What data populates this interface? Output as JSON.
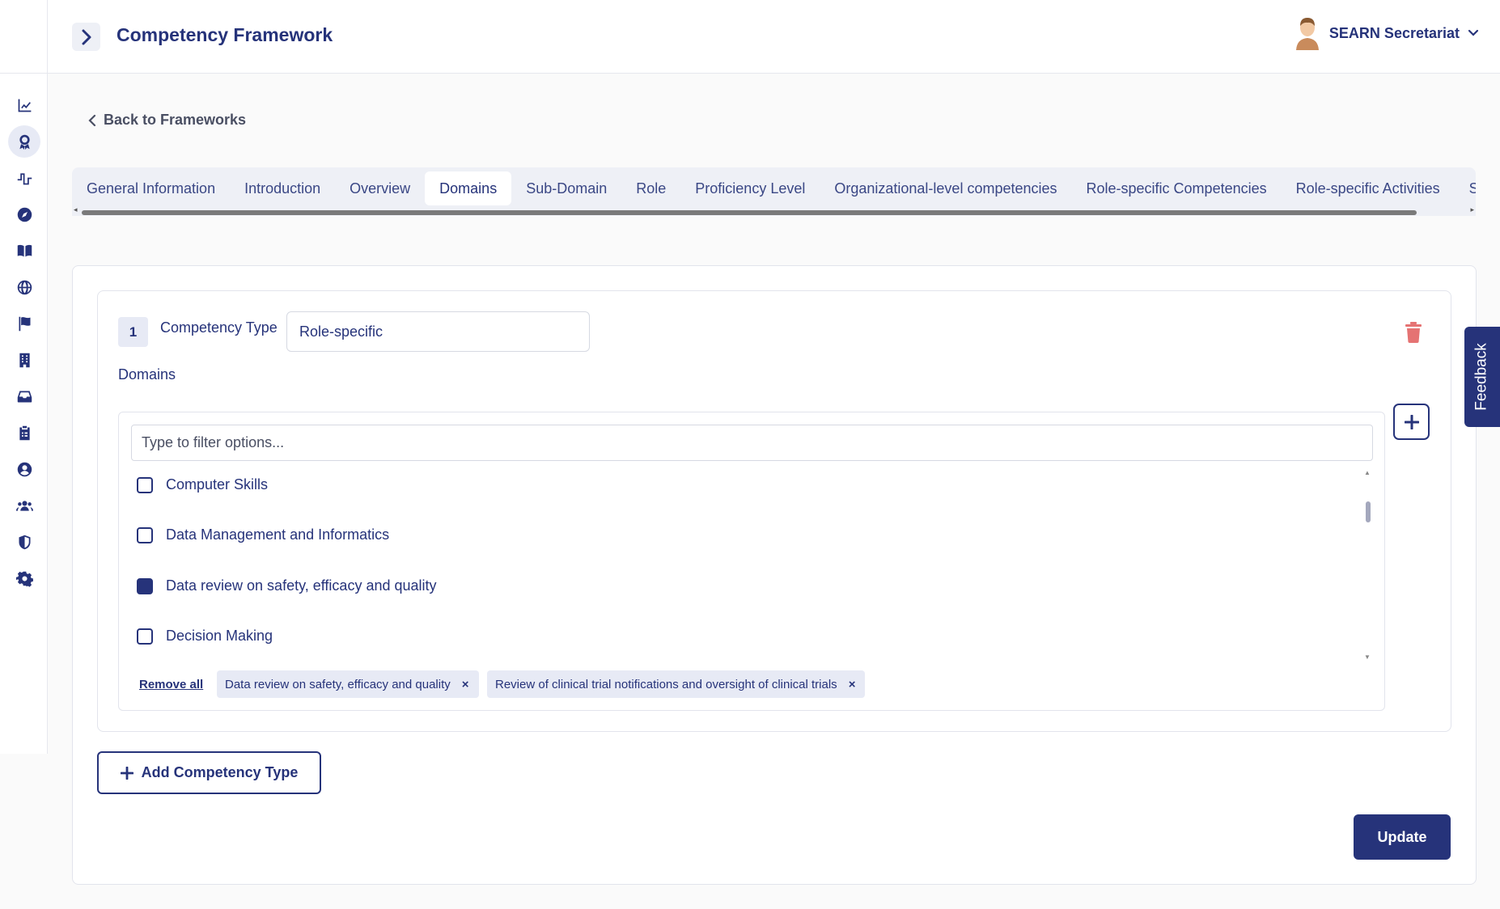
{
  "header": {
    "page_title": "Competency Framework",
    "user_name": "SEARN Secretariat"
  },
  "sidebar": {
    "items": [
      {
        "icon": "chart-line-icon"
      },
      {
        "icon": "award-icon",
        "active": true
      },
      {
        "icon": "pulse-icon"
      },
      {
        "icon": "compass-icon"
      },
      {
        "icon": "book-icon"
      },
      {
        "icon": "globe-icon"
      },
      {
        "icon": "flag-icon"
      },
      {
        "icon": "building-icon"
      },
      {
        "icon": "inbox-icon"
      },
      {
        "icon": "clipboard-icon"
      },
      {
        "icon": "user-circle-icon"
      },
      {
        "icon": "users-icon"
      },
      {
        "icon": "shield-icon"
      },
      {
        "icon": "gear-icon"
      }
    ]
  },
  "back_link": "Back to Frameworks",
  "tabs": [
    {
      "label": "General Information"
    },
    {
      "label": "Introduction"
    },
    {
      "label": "Overview"
    },
    {
      "label": "Domains",
      "active": true
    },
    {
      "label": "Sub-Domain"
    },
    {
      "label": "Role"
    },
    {
      "label": "Proficiency Level"
    },
    {
      "label": "Organizational-level competencies"
    },
    {
      "label": "Role-specific Competencies"
    },
    {
      "label": "Role-specific Activities"
    },
    {
      "label": "Sugges"
    }
  ],
  "competency": {
    "number": "1",
    "type_label": "Competency Type",
    "type_value": "Role-specific",
    "domains_label": "Domains",
    "filter_placeholder": "Type to filter options...",
    "options": [
      {
        "label": "Computer Skills",
        "checked": false
      },
      {
        "label": "Data Management and Informatics",
        "checked": false
      },
      {
        "label": "Data review on safety, efficacy and quality",
        "checked": true
      },
      {
        "label": "Decision Making",
        "checked": false
      }
    ],
    "remove_all": "Remove all",
    "selected": [
      "Data review on safety, efficacy and quality",
      "Review of clinical trial notifications and oversight of clinical trials"
    ]
  },
  "buttons": {
    "add_competency_type": "Add Competency Type",
    "update": "Update",
    "feedback": "Feedback"
  },
  "colors": {
    "primary": "#26337a",
    "tab_bg": "#eef0f6",
    "chip_bg": "#e7eaf5",
    "delete": "#e57373"
  }
}
